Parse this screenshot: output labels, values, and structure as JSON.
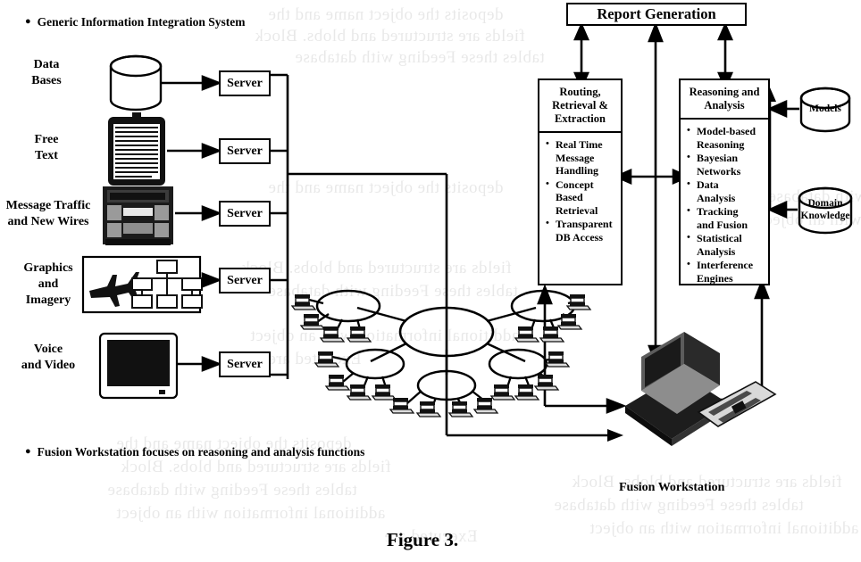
{
  "figure": {
    "caption": "Figure 3.",
    "top_bullet": "Generic Information Integration System",
    "bottom_bullet": "Fusion Workstation focuses on reasoning and analysis functions"
  },
  "sources": [
    {
      "label": "Data\nBases",
      "icon": "database-cylinder-icon",
      "server": "Server"
    },
    {
      "label": "Free\nText",
      "icon": "clipboard-document-icon",
      "server": "Server"
    },
    {
      "label": "Message Traffic\nand New Wires",
      "icon": "teletype-machine-icon",
      "server": "Server"
    },
    {
      "label": "Graphics\nand\nImagery",
      "icon": "jet-and-orgchart-icon",
      "server": "Server"
    },
    {
      "label": "Voice\nand Video",
      "icon": "crt-monitor-icon",
      "server": "Server"
    }
  ],
  "panels": [
    {
      "title": "Routing,\nRetrieval &\nExtraction",
      "items": [
        "Real Time\nMessage\nHandling",
        "Concept\nBased\nRetrieval",
        "Transparent\nDB Access"
      ]
    },
    {
      "title": "Reasoning and\nAnalysis",
      "items": [
        "Model-based\nReasoning",
        "Bayesian\nNetworks",
        "Data\nAnalysis",
        "Tracking\nand Fusion",
        "Statistical\nAnalysis",
        "Interference\nEngines"
      ]
    }
  ],
  "report": {
    "label": "Report Generation"
  },
  "knowledge_stores": [
    {
      "label": "Models",
      "icon": "database-cylinder-icon"
    },
    {
      "label": "Domain\nKnowledge",
      "icon": "database-cylinder-icon"
    }
  ],
  "workstation": {
    "label": "Fusion Workstation",
    "icon": "isometric-computer-icon"
  },
  "network": {
    "hub_count": 5,
    "terminals_per_hub": [
      4,
      4,
      4,
      4,
      4
    ],
    "terminal_icon": "workstation-terminal-icon"
  },
  "ghost_text": [
    "deposits the object name and the",
    "fields are structured and blobs.  Block",
    "tables these  Feeding with database",
    "additional information with an object",
    "Executed are"
  ],
  "colors": {
    "ink": "#000000",
    "paper": "#ffffff",
    "fill_gray": "#9a9a9a",
    "fill_dark": "#2b2b2b"
  }
}
